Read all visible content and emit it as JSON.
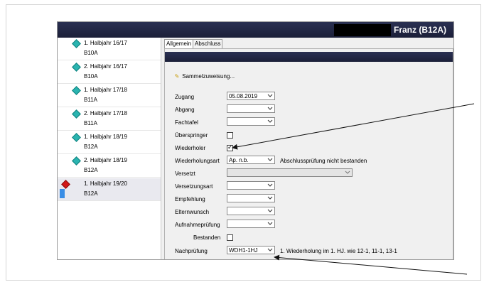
{
  "window": {
    "title": "Franz (B12A)"
  },
  "sidebar": {
    "items": [
      {
        "line1": "1. Halbjahr 16/17",
        "line2": "B10A"
      },
      {
        "line1": "2. Halbjahr 16/17",
        "line2": "B10A"
      },
      {
        "line1": "1. Halbjahr 17/18",
        "line2": "B11A"
      },
      {
        "line1": "2. Halbjahr 17/18",
        "line2": "B11A"
      },
      {
        "line1": "1. Halbjahr 18/19",
        "line2": "B12A"
      },
      {
        "line1": "2. Halbjahr 18/19",
        "line2": "B12A"
      },
      {
        "line1": "1. Halbjahr 19/20",
        "line2": "B12A"
      }
    ]
  },
  "tabs": {
    "allgemein": "Allgemein",
    "abschluss": "Abschluss"
  },
  "form": {
    "sammel": "Sammelzuweisung...",
    "zugang": {
      "label": "Zugang",
      "value": "05.08.2019"
    },
    "abgang": {
      "label": "Abgang",
      "value": ""
    },
    "fachtafel": {
      "label": "Fachtafel",
      "value": ""
    },
    "ueberspringer": {
      "label": "Überspringer",
      "checked": false
    },
    "wiederholer": {
      "label": "Wiederholer",
      "checked": true
    },
    "wiederholungsart": {
      "label": "Wiederholungsart",
      "value": "Ap. n.b.",
      "info": "Abschlussprüfung nicht bestanden"
    },
    "versetzt": {
      "label": "Versetzt",
      "value": ""
    },
    "versetzungsart": {
      "label": "Versetzungsart",
      "value": ""
    },
    "empfehlung": {
      "label": "Empfehlung",
      "value": ""
    },
    "elternwunsch": {
      "label": "Elternwunsch",
      "value": ""
    },
    "aufnahmepruefung": {
      "label": "Aufnahmeprüfung",
      "value": ""
    },
    "bestanden": {
      "label": "Bestanden",
      "checked": false
    },
    "nachpruefung": {
      "label": "Nachprüfung",
      "value": "WDH1-1HJ",
      "info": "1. Wiederholung im 1. HJ. wie 12-1, 11-1, 13-1"
    }
  }
}
